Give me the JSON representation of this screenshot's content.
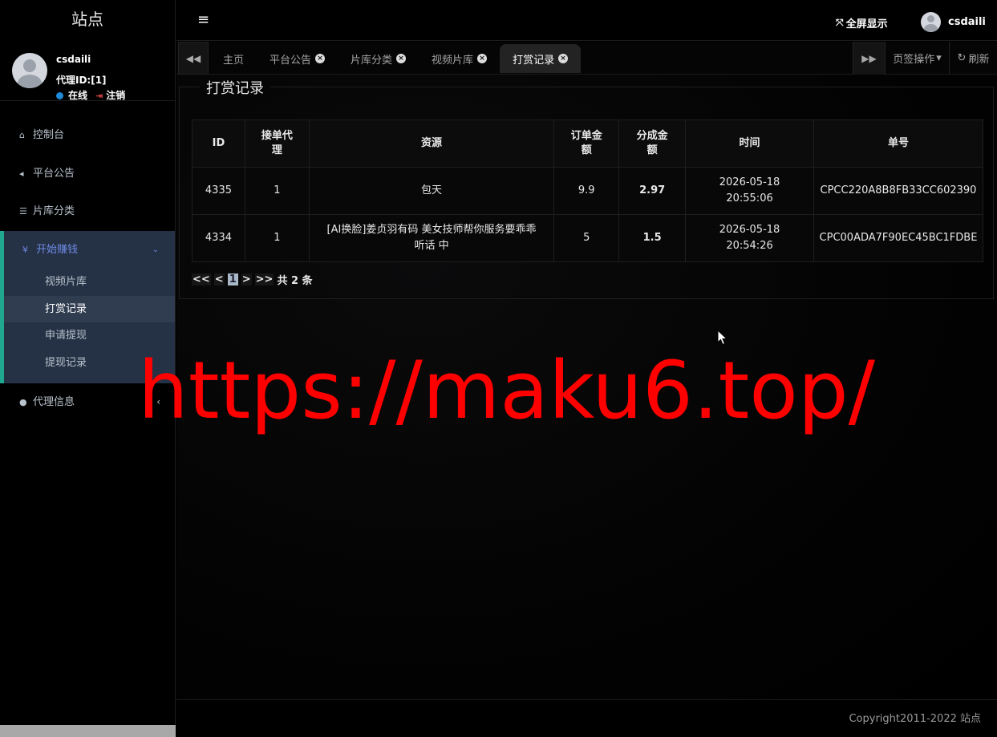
{
  "sidebar": {
    "brand": "站点",
    "user": {
      "name": "csdaili",
      "agent_id": "代理ID:[1]",
      "status": "在线",
      "logout": "注销"
    },
    "menu": [
      {
        "label": "控制台",
        "icon": "home-icon"
      },
      {
        "label": "平台公告",
        "icon": "bullhorn-icon"
      },
      {
        "label": "片库分类",
        "icon": "list-icon"
      },
      {
        "label": "开始赚钱",
        "icon": "yen-icon",
        "expanded": true,
        "children": [
          "视频片库",
          "打赏记录",
          "申请提现",
          "提现记录"
        ]
      },
      {
        "label": "代理信息",
        "icon": "user-icon"
      }
    ]
  },
  "header": {
    "fullscreen": "全屏显示",
    "user": "csdaili"
  },
  "tabs": [
    {
      "label": "主页",
      "closable": false
    },
    {
      "label": "平台公告",
      "closable": true
    },
    {
      "label": "片库分类",
      "closable": true
    },
    {
      "label": "视频片库",
      "closable": true
    },
    {
      "label": "打赏记录",
      "closable": true,
      "active": true
    }
  ],
  "tab_tools": {
    "page_ops": "页签操作",
    "refresh": "刷新"
  },
  "panel": {
    "title": "打赏记录",
    "columns": [
      "ID",
      "接单代理",
      "资源",
      "订单金额",
      "分成金额",
      "时间",
      "单号"
    ],
    "rows": [
      {
        "id": "4335",
        "agent": "1",
        "resource": "包天",
        "order_amount": "9.9",
        "commission": "2.97",
        "time": "2026-05-18 20:55:06",
        "order_no": "CPCC220A8B8FB33CC602390"
      },
      {
        "id": "4334",
        "agent": "1",
        "resource": "[AI换脸]姜贞羽有码 美女技师帮你服务要乖乖听话 中",
        "order_amount": "5",
        "commission": "1.5",
        "time": "2026-05-18 20:54:26",
        "order_no": "CPC00ADA7F90EC45BC1FDBE"
      }
    ],
    "pager": {
      "first": "<<",
      "prev": "<",
      "current": "1",
      "next": ">",
      "last": ">>",
      "total": "共 2 条"
    }
  },
  "footer": {
    "copyright": "Copyright2011-2022 站点"
  },
  "watermark": "https://maku6.top/"
}
